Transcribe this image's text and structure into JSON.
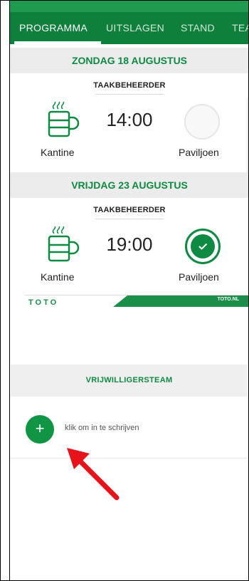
{
  "tabs": [
    {
      "label": "PROGRAMMA",
      "active": true
    },
    {
      "label": "UITSLAGEN",
      "active": false
    },
    {
      "label": "STAND",
      "active": false
    },
    {
      "label": "TEA",
      "active": false
    }
  ],
  "events": [
    {
      "date": "ZONDAG 18 AUGUSTUS",
      "role": "TAAKBEHEERDER",
      "time": "14:00",
      "left_location": "Kantine",
      "right_location": "Paviljoen",
      "status": "open"
    },
    {
      "date": "VRIJDAG 23 AUGUSTUS",
      "role": "TAAKBEHEERDER",
      "time": "19:00",
      "left_location": "Kantine",
      "right_location": "Paviljoen",
      "status": "done"
    }
  ],
  "banner": {
    "logo": "TOTO",
    "site": "TOTO.NL"
  },
  "volunteers": {
    "heading": "VRIJWILLIGERSTEAM",
    "add_label": "+",
    "signup_text": "klik om in te schrijven"
  },
  "colors": {
    "accent": "#0f8a43",
    "tabbar": "#0f7f3c",
    "annotation_arrow": "#e5141b"
  }
}
